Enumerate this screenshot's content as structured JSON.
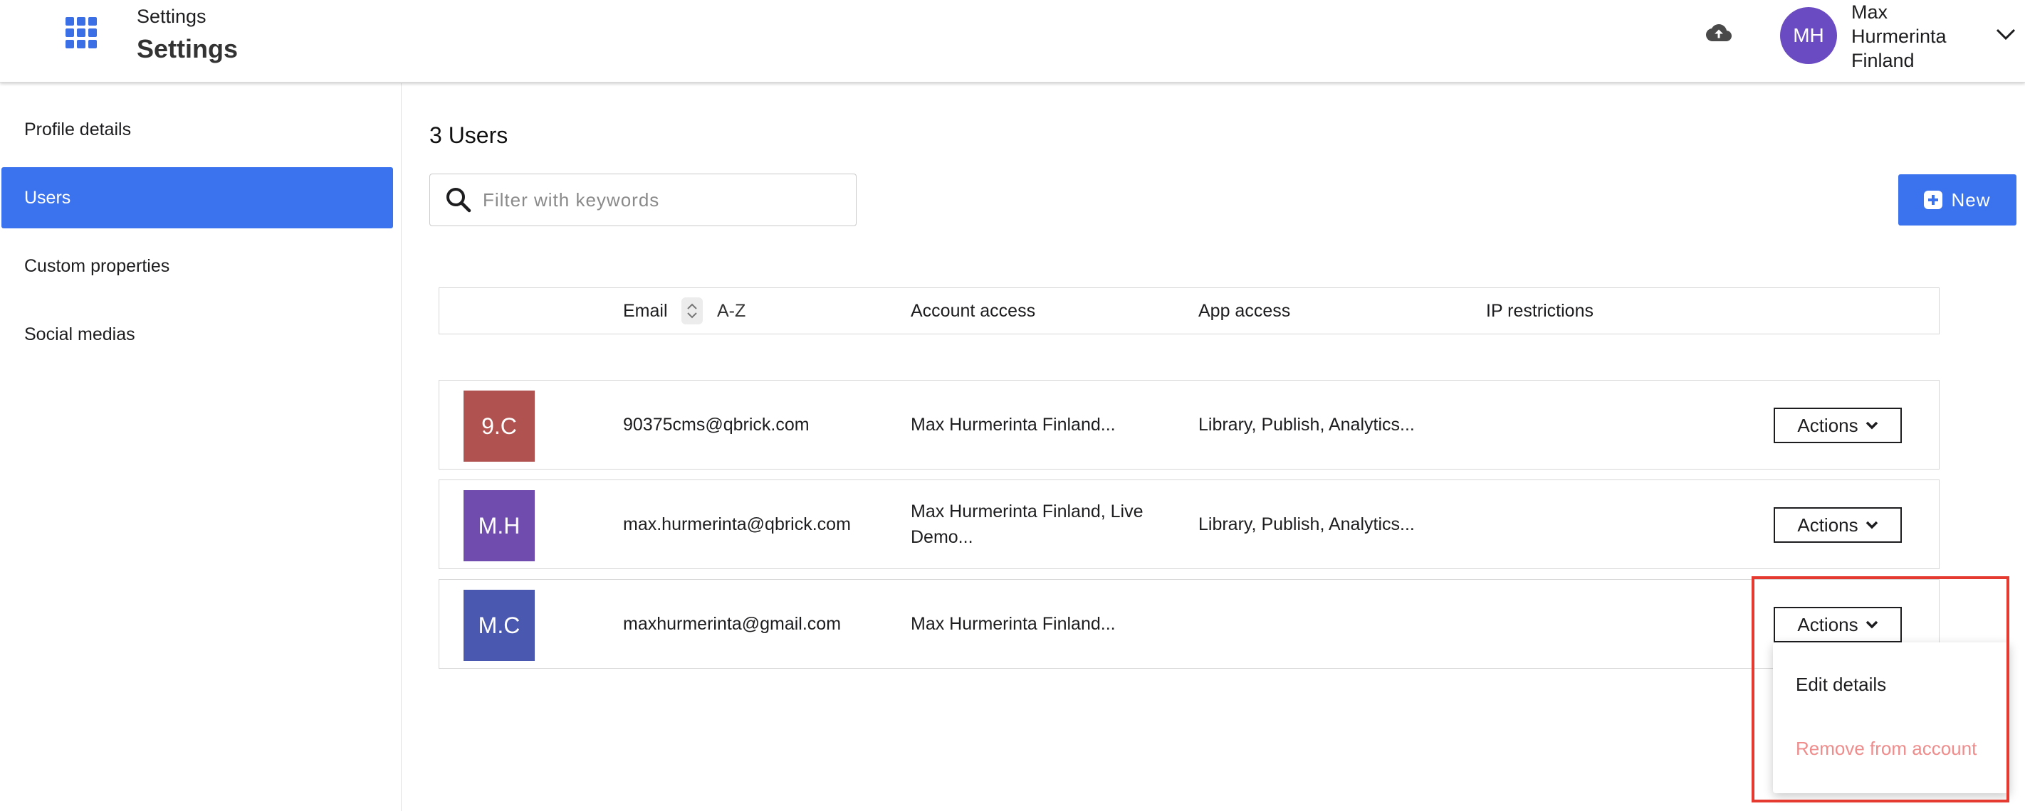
{
  "header": {
    "breadcrumb": "Settings",
    "title": "Settings",
    "user": {
      "initials": "MH",
      "name_lines": [
        "Max",
        "Hurmerinta",
        "Finland"
      ]
    },
    "icons": [
      "apps-grid-icon",
      "cloud-upload-icon",
      "chevron-down-icon"
    ]
  },
  "sidebar": {
    "items": [
      {
        "label": "Profile details",
        "active": false
      },
      {
        "label": "Users",
        "active": true
      },
      {
        "label": "Custom properties",
        "active": false
      },
      {
        "label": "Social medias",
        "active": false
      }
    ]
  },
  "main": {
    "users_count": "3 Users",
    "search": {
      "placeholder": "Filter with keywords",
      "value": ""
    },
    "new_button": "New",
    "table": {
      "headers": {
        "email": "Email",
        "sort": "A-Z",
        "account_access": "Account access",
        "app_access": "App access",
        "ip_restrictions": "IP restrictions"
      },
      "rows": [
        {
          "initials": "9.C",
          "color": "#b0524f",
          "email": "90375cms@qbrick.com",
          "account_access": "Max Hurmerinta Finland...",
          "app_access": "Library, Publish, Analytics...",
          "ip_restrictions": "",
          "actions": "Actions"
        },
        {
          "initials": "M.H",
          "color": "#6f4cad",
          "email": "max.hurmerinta@qbrick.com",
          "account_access": "Max Hurmerinta Finland, Live Demo...",
          "app_access": "Library, Publish, Analytics...",
          "ip_restrictions": "",
          "actions": "Actions"
        },
        {
          "initials": "M.C",
          "color": "#4b58b0",
          "email": "maxhurmerinta@gmail.com",
          "account_access": "Max Hurmerinta Finland...",
          "app_access": "",
          "ip_restrictions": "",
          "actions": "Actions"
        }
      ]
    },
    "actions_menu": {
      "edit": "Edit details",
      "remove": "Remove from account"
    }
  },
  "colors": {
    "primary": "#3b73ef",
    "avatar": "#6b4bc2",
    "danger_text": "#ef8c8c",
    "highlight": "#e53a2f"
  }
}
